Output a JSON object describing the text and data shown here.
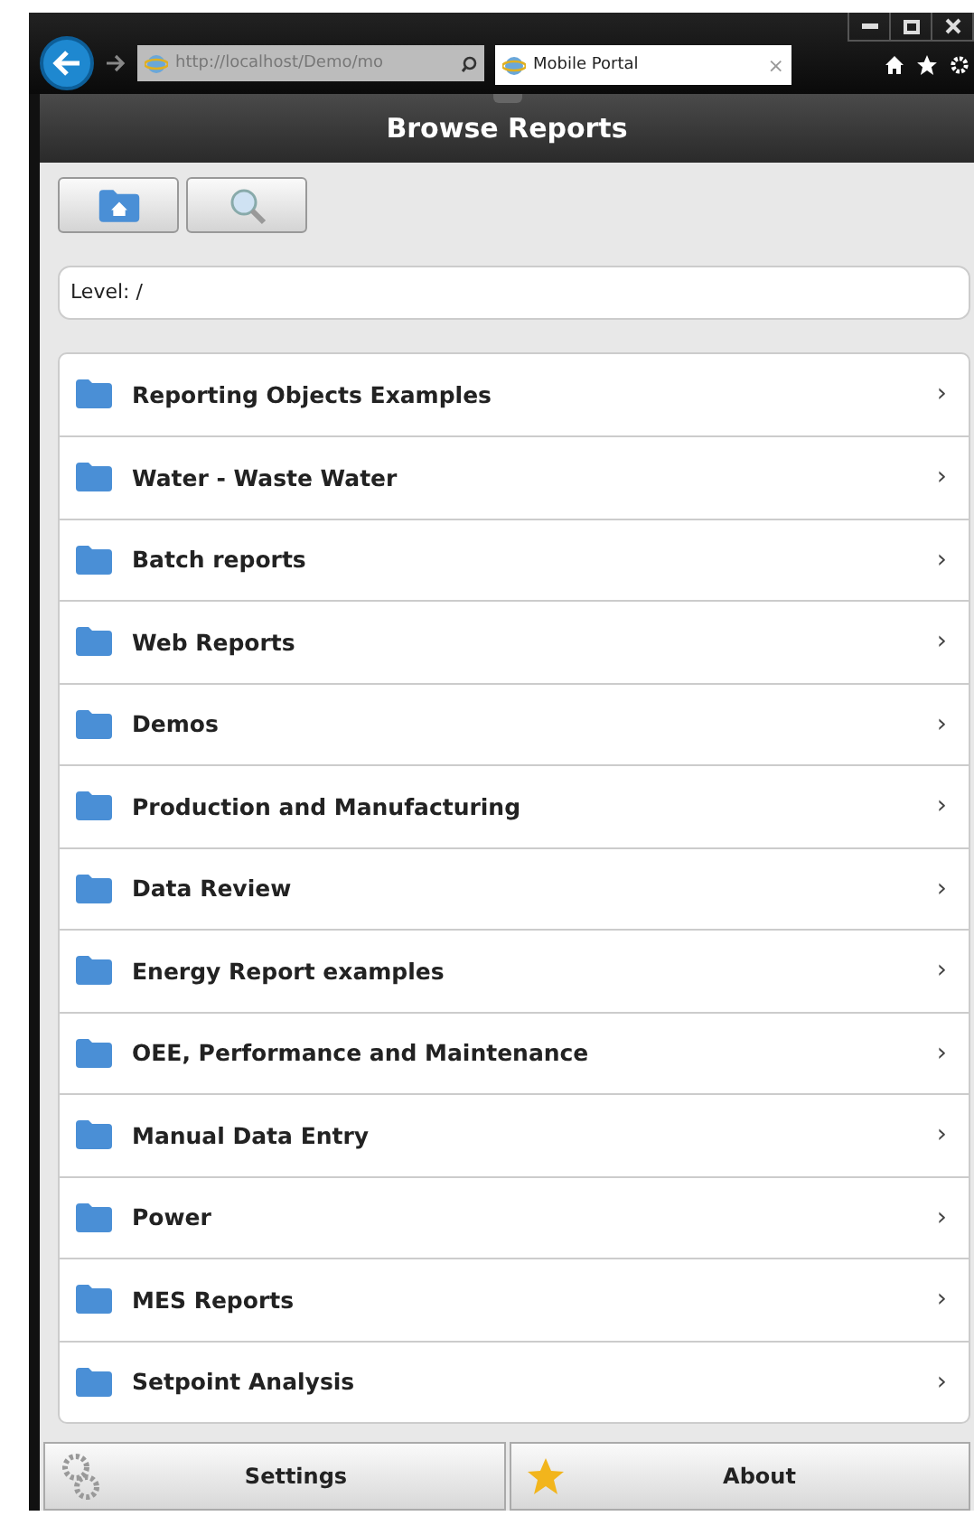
{
  "browser": {
    "address": "http://localhost/Demo/mo",
    "tab": {
      "title": "Mobile Portal",
      "close": "×"
    }
  },
  "header": {
    "title": "Browse Reports"
  },
  "level": {
    "value": "Level: /"
  },
  "folders": [
    {
      "name": "Reporting Objects Examples",
      "chevron": "›"
    },
    {
      "name": "Water - Waste Water",
      "chevron": "›"
    },
    {
      "name": "Batch reports",
      "chevron": "›"
    },
    {
      "name": "Web Reports",
      "chevron": "›"
    },
    {
      "name": "Demos",
      "chevron": "›"
    },
    {
      "name": "Production and Manufacturing",
      "chevron": "›"
    },
    {
      "name": "Data Review",
      "chevron": "›"
    },
    {
      "name": "Energy Report examples",
      "chevron": "›"
    },
    {
      "name": "OEE, Performance and Maintenance",
      "chevron": "›"
    },
    {
      "name": "Manual Data Entry",
      "chevron": "›"
    },
    {
      "name": "Power",
      "chevron": "›"
    },
    {
      "name": "MES Reports",
      "chevron": "›"
    },
    {
      "name": "Setpoint Analysis",
      "chevron": "›"
    }
  ],
  "footer": [
    {
      "label": "Settings",
      "kind": "gears"
    },
    {
      "label": "About",
      "kind": "star"
    }
  ]
}
